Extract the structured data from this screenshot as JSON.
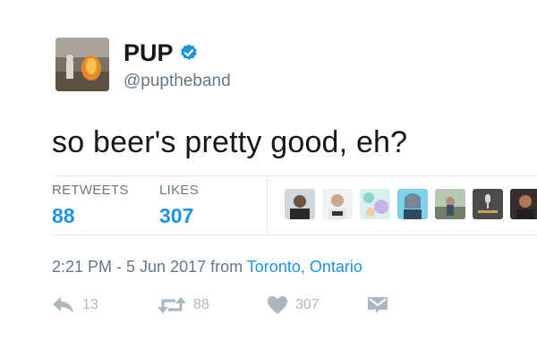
{
  "tweet": {
    "display_name": "PUP",
    "handle": "@puptheband",
    "text": "so beer's pretty good, eh?",
    "verified": true,
    "verified_icon": "verified-badge-icon"
  },
  "stats": {
    "retweets_label": "RETWEETS",
    "retweets_value": "88",
    "likes_label": "LIKES",
    "likes_value": "307"
  },
  "meta": {
    "time_date": "2:21 PM - 5 Jun 2017 from ",
    "location": "Toronto, Ontario"
  },
  "actions": {
    "reply_count": "13",
    "retweet_count": "88",
    "like_count": "307",
    "reply_icon": "reply-icon",
    "retweet_icon": "retweet-icon",
    "like_icon": "heart-icon",
    "message_icon": "envelope-icon"
  },
  "colors": {
    "accent": "#1c94e0",
    "muted": "#657786",
    "icon_muted": "#aab8c2",
    "text": "#14171a"
  }
}
